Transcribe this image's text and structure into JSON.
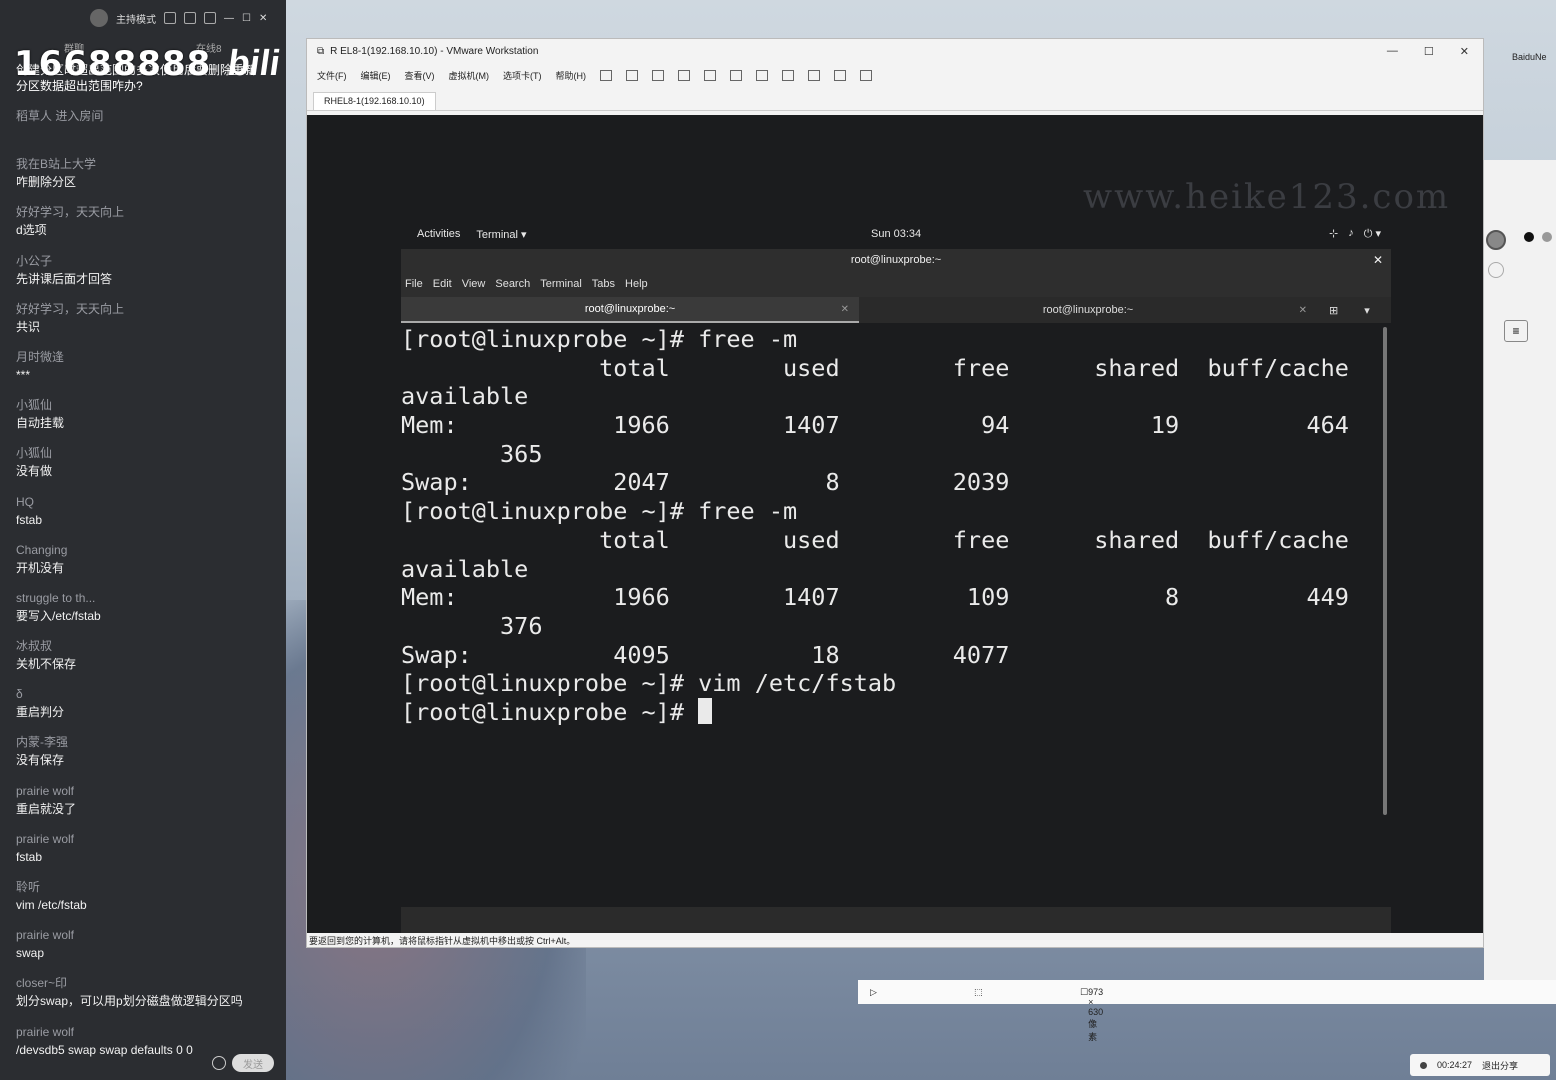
{
  "sidebar": {
    "mode_label": "主持模式",
    "overlay_number": "16688888",
    "overlay_logo": "bili",
    "label_left": "群聊",
    "label_right": "在线8",
    "first_message": "创建分区时超出范围的多次使用后要删除重新分区数据超出范围咋办?",
    "messages": [
      {
        "user": "稻草人 进入房间",
        "text": ""
      },
      {
        "user": "我在B站上大学",
        "text": "咋删除分区"
      },
      {
        "user": "好好学习，天天向上",
        "text": "d选项"
      },
      {
        "user": "小公子",
        "text": "先讲课后面才回答"
      },
      {
        "user": "好好学习，天天向上",
        "text": "共识"
      },
      {
        "user": "月时微逢",
        "text": "***"
      },
      {
        "user": "小狐仙",
        "text": "自动挂载"
      },
      {
        "user": "小狐仙",
        "text": "没有做"
      },
      {
        "user": "HQ",
        "text": "fstab"
      },
      {
        "user": "Changing",
        "text": "开机没有"
      },
      {
        "user": "struggle to th...",
        "text": "要写入/etc/fstab"
      },
      {
        "user": "冰叔叔",
        "text": "关机不保存"
      },
      {
        "user": "δ",
        "text": "重启判分"
      },
      {
        "user": "内蒙-李强",
        "text": "没有保存"
      },
      {
        "user": "prairie wolf",
        "text": "重启就没了"
      },
      {
        "user": "prairie wolf",
        "text": "fstab"
      },
      {
        "user": "聆听",
        "text": "vim /etc/fstab"
      },
      {
        "user": "prairie wolf",
        "text": "swap"
      },
      {
        "user": "closer~印",
        "text": "划分swap，可以用p划分磁盘做逻辑分区吗"
      },
      {
        "user": "prairie wolf",
        "text": "/devsdb5 swap swap defaults 0 0"
      }
    ],
    "send_label": "发送"
  },
  "vmware": {
    "title": "R  EL8-1(192.168.10.10) - VMware Workstation",
    "menu": [
      "文件(F)",
      "编辑(E)",
      "查看(V)",
      "虚拟机(M)",
      "选项卡(T)",
      "帮助(H)"
    ],
    "tab_label": "RHEL8-1(192.168.10.10)",
    "status_text": "要返回到您的计算机，请将鼠标指针从虚拟机中移出或按 Ctrl+Alt。",
    "watermark": "www.heike123.com"
  },
  "gnome": {
    "activities": "Activities",
    "terminal_menu": "Terminal ▾",
    "clock": "Sun 03:34"
  },
  "terminal": {
    "window_title": "root@linuxprobe:~",
    "menu": [
      "File",
      "Edit",
      "View",
      "Search",
      "Terminal",
      "Tabs",
      "Help"
    ],
    "tabs": [
      "root@linuxprobe:~",
      "root@linuxprobe:~"
    ],
    "lines": [
      "[root@linuxprobe ~]# free -m",
      "              total        used        free      shared  buff/cache",
      "available",
      "Mem:           1966        1407          94          19         464",
      "       365",
      "Swap:          2047           8        2039",
      "[root@linuxprobe ~]# free -m",
      "              total        used        free      shared  buff/cache",
      "available",
      "Mem:           1966        1407         109           8         449",
      "       376",
      "Swap:          4095          18        4077",
      "[root@linuxprobe ~]# vim /etc/fstab",
      "[root@linuxprobe ~]# "
    ]
  },
  "capture": {
    "size_label": "973 × 630像素"
  },
  "right_panel": {
    "label": "BaiduNe"
  },
  "share": {
    "timer": "00:24:27",
    "exit_label": "退出分享"
  }
}
